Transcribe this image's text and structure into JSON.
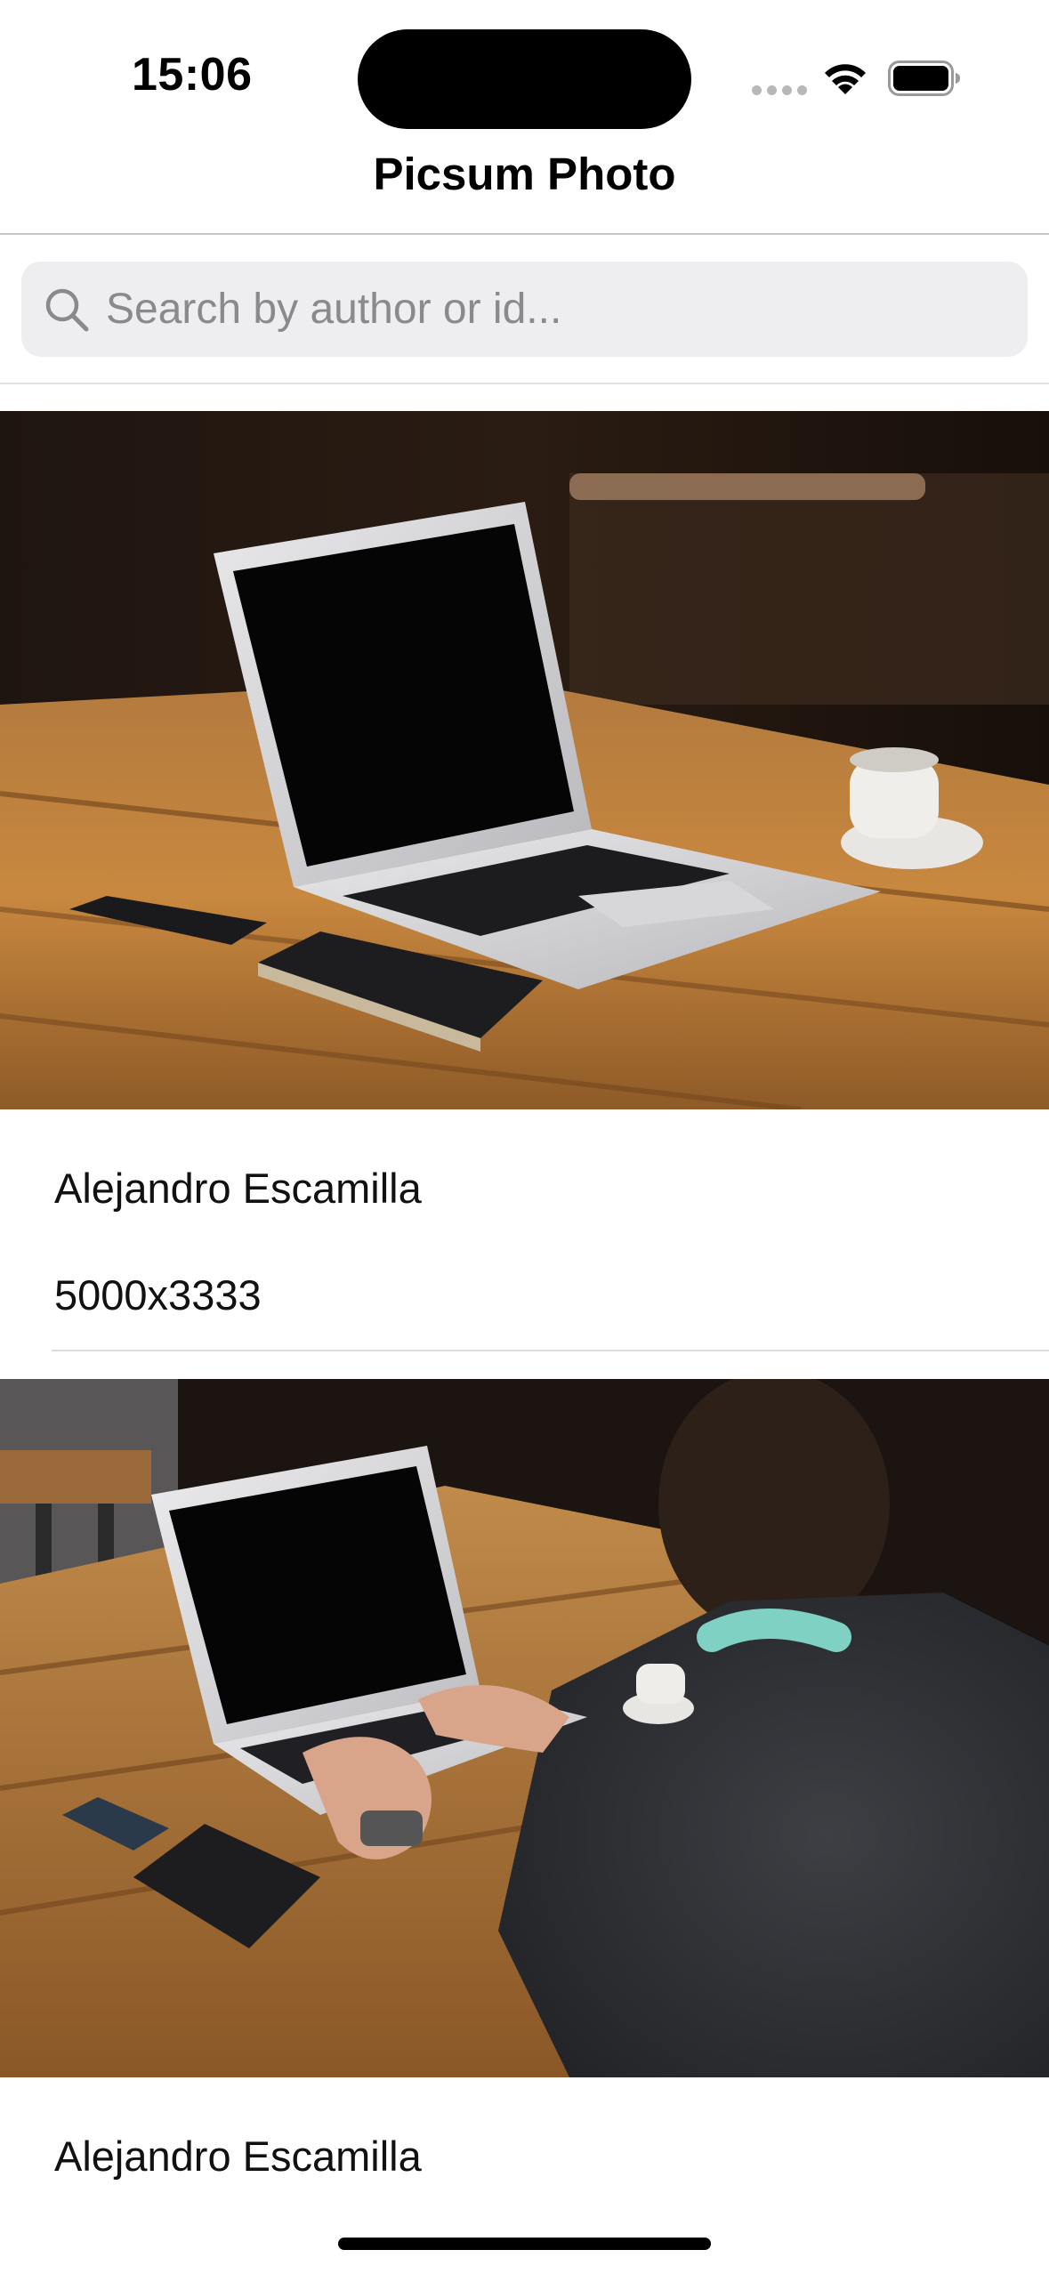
{
  "status_bar": {
    "time": "15:06",
    "icons": [
      "cellular-signal-icon",
      "wifi-icon",
      "battery-icon"
    ]
  },
  "nav": {
    "title": "Picsum Photo"
  },
  "search": {
    "placeholder": "Search by author or id...",
    "value": "",
    "icon": "search-icon"
  },
  "photos": [
    {
      "author": "Alejandro Escamilla",
      "dimensions": "5000x3333",
      "image": "laptop-on-wooden-table-photo"
    },
    {
      "author": "Alejandro Escamilla",
      "image": "person-typing-on-laptop-photo"
    }
  ],
  "colors": {
    "background": "#ffffff",
    "search_fill": "#eeeef0",
    "placeholder": "#8a8a8e",
    "divider": "#c8c8cc"
  }
}
